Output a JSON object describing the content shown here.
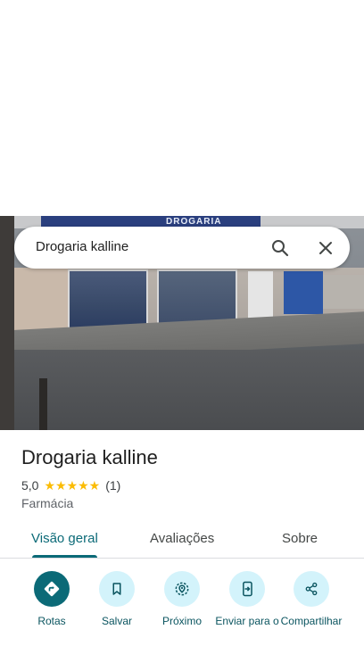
{
  "photo": {
    "sign_text": "DROGARIA"
  },
  "search": {
    "query": "Drogaria kalline"
  },
  "place": {
    "title": "Drogaria kalline",
    "rating": "5,0",
    "stars": "★★★★★",
    "review_count": "(1)",
    "category": "Farmácia"
  },
  "tabs": [
    {
      "label": "Visão geral",
      "active": true
    },
    {
      "label": "Avaliações",
      "active": false
    },
    {
      "label": "Sobre",
      "active": false
    }
  ],
  "actions": [
    {
      "label": "Rotas",
      "icon": "directions-icon"
    },
    {
      "label": "Salvar",
      "icon": "bookmark-icon"
    },
    {
      "label": "Próximo",
      "icon": "nearby-icon"
    },
    {
      "label": "Enviar para o",
      "icon": "send-to-phone-icon"
    },
    {
      "label": "Compartilhar",
      "icon": "share-icon"
    }
  ],
  "colors": {
    "accent": "#0b6a77",
    "action_bg": "#d3f3fb",
    "star": "#fbbc04"
  }
}
